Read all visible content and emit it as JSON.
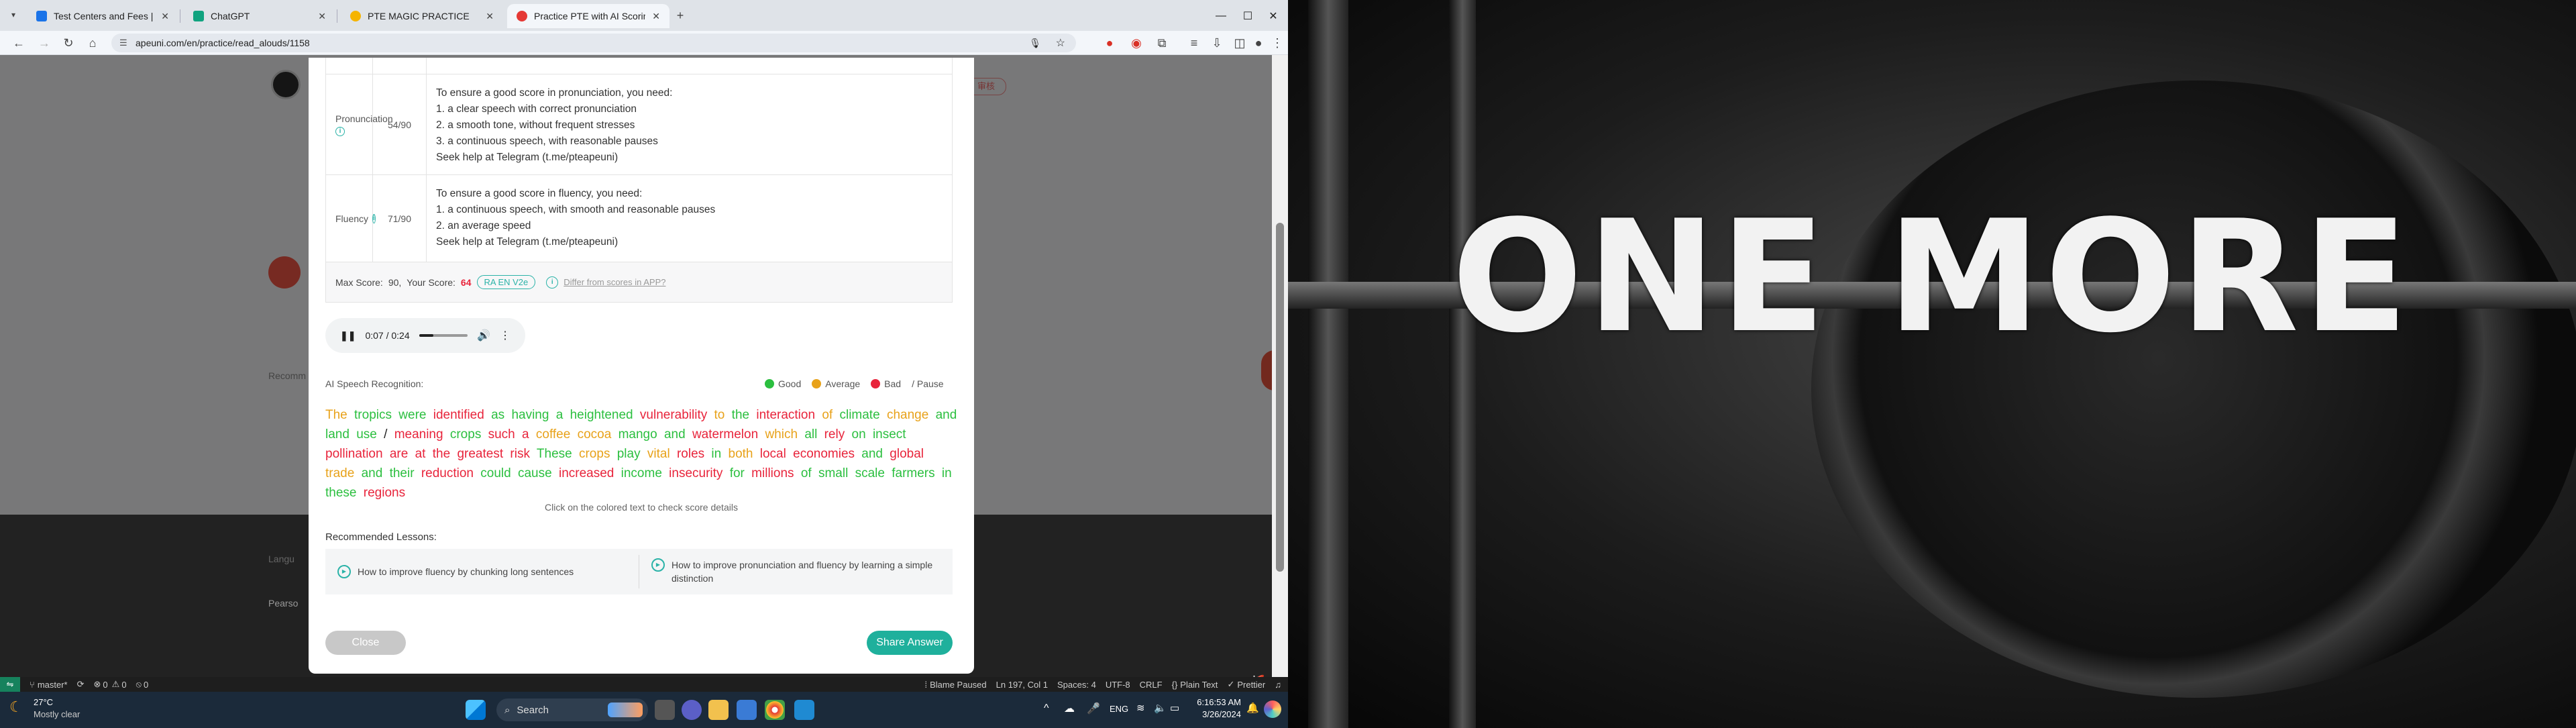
{
  "browser": {
    "tabs": [
      {
        "title": "Test Centers and Fees | Pearson",
        "color": "#1a73e8"
      },
      {
        "title": "ChatGPT",
        "color": "#10a37f"
      },
      {
        "title": "PTE MAGIC PRACTICE",
        "color": "#f5b400"
      },
      {
        "title": "Practice PTE with AI Scoring",
        "color": "#e53935"
      }
    ],
    "url": "apeuni.com/en/practice/read_alouds/1158"
  },
  "modal": {
    "scores": [
      {
        "label": "Pronunciation",
        "score": "54/90",
        "tips": [
          "To ensure a good score in pronunciation, you need:",
          "1. a clear speech with correct pronunciation",
          "2. a smooth tone, without frequent stresses",
          "3. a continuous speech, with reasonable pauses",
          "Seek help at Telegram (t.me/pteapeuni)"
        ]
      },
      {
        "label": "Fluency",
        "score": "71/90",
        "tips": [
          "To ensure a good score in fluency, you need:",
          "1. a continuous speech, with smooth and reasonable pauses",
          "2. an average speed",
          "Seek help at Telegram (t.me/pteapeuni)"
        ]
      }
    ],
    "max_score_label": "Max Score:",
    "max_score": "90,",
    "your_score_label": "Your Score:",
    "your_score": "64",
    "version_badge": "RA EN V2e",
    "differ_link": "Differ from scores in APP?",
    "audio": {
      "time": "0:07 / 0:24",
      "progress": 0.29
    },
    "speech_label": "AI Speech Recognition:",
    "legend": [
      {
        "label": "Good",
        "color": "#2bbf3f"
      },
      {
        "label": "Average",
        "color": "#e8a21a"
      },
      {
        "label": "Bad",
        "color": "#e8243b"
      },
      {
        "label": "/  Pause"
      }
    ],
    "transcript": [
      [
        "The",
        "a"
      ],
      [
        "tropics",
        "g"
      ],
      [
        "were",
        "g"
      ],
      [
        "identified",
        "b"
      ],
      [
        "as",
        "g"
      ],
      [
        "having",
        "g"
      ],
      [
        "a",
        "g"
      ],
      [
        "heightened",
        "g"
      ],
      [
        "vulnerability",
        "b"
      ],
      [
        "to",
        "a"
      ],
      [
        "the",
        "g"
      ],
      [
        "interaction",
        "b"
      ],
      [
        "of",
        "a"
      ],
      [
        "climate",
        "g"
      ],
      [
        "change",
        "a"
      ],
      [
        "and",
        "g"
      ],
      [
        "land",
        "g"
      ],
      [
        "use",
        "g"
      ],
      [
        "/",
        "k"
      ],
      [
        "meaning",
        "b"
      ],
      [
        "crops",
        "g"
      ],
      [
        "such",
        "b"
      ],
      [
        "a",
        "b"
      ],
      [
        "coffee",
        "a"
      ],
      [
        "cocoa",
        "a"
      ],
      [
        "mango",
        "g"
      ],
      [
        "and",
        "g"
      ],
      [
        "watermelon",
        "b"
      ],
      [
        "which",
        "a"
      ],
      [
        "all",
        "g"
      ],
      [
        "rely",
        "b"
      ],
      [
        "on",
        "g"
      ],
      [
        "insect",
        "g"
      ],
      [
        "pollination",
        "b"
      ],
      [
        "are",
        "b"
      ],
      [
        "at",
        "b"
      ],
      [
        "the",
        "b"
      ],
      [
        "greatest",
        "b"
      ],
      [
        "risk",
        "b"
      ],
      [
        "These",
        "g"
      ],
      [
        "crops",
        "a"
      ],
      [
        "play",
        "g"
      ],
      [
        "vital",
        "a"
      ],
      [
        "roles",
        "b"
      ],
      [
        "in",
        "g"
      ],
      [
        "both",
        "a"
      ],
      [
        "local",
        "b"
      ],
      [
        "economies",
        "b"
      ],
      [
        "and",
        "g"
      ],
      [
        "global",
        "b"
      ],
      [
        "trade",
        "a"
      ],
      [
        "and",
        "g"
      ],
      [
        "their",
        "g"
      ],
      [
        "reduction",
        "b"
      ],
      [
        "could",
        "g"
      ],
      [
        "cause",
        "g"
      ],
      [
        "increased",
        "b"
      ],
      [
        "income",
        "g"
      ],
      [
        "insecurity",
        "b"
      ],
      [
        "for",
        "g"
      ],
      [
        "millions",
        "b"
      ],
      [
        "of",
        "g"
      ],
      [
        "small",
        "g"
      ],
      [
        "scale",
        "g"
      ],
      [
        "farmers",
        "g"
      ],
      [
        "in",
        "g"
      ],
      [
        "these",
        "g"
      ],
      [
        "regions",
        "b"
      ]
    ],
    "click_hint": "Click on the colored text to check score details",
    "recommended_label": "Recommended Lessons:",
    "lessons": [
      "How to improve fluency by chunking long sentences",
      "How to improve pronunciation and fluency by learning a simple distinction"
    ],
    "close_label": "Close",
    "share_label": "Share Answer"
  },
  "background_page": {
    "right_badge": "审核",
    "recommend_frag": "Recomm",
    "lang_frag": "Langu",
    "pearson_frag": "Pearso"
  },
  "vscode_status": {
    "branch": "master*",
    "errors": "0",
    "warnings": "0",
    "ports": "0",
    "blame": "Blame Paused",
    "position": "Ln 197, Col 1",
    "spaces": "Spaces: 4",
    "encoding": "UTF-8",
    "eol": "CRLF",
    "language": "Plain Text",
    "formatter": "Prettier"
  },
  "taskbar": {
    "weather_temp": "27°C",
    "weather_desc": "Mostly clear",
    "search_placeholder": "Search",
    "lang": "ENG",
    "time": "6:16:53 AM",
    "date": "3/26/2024"
  },
  "wallpaper": {
    "text": "ONE MORE"
  }
}
